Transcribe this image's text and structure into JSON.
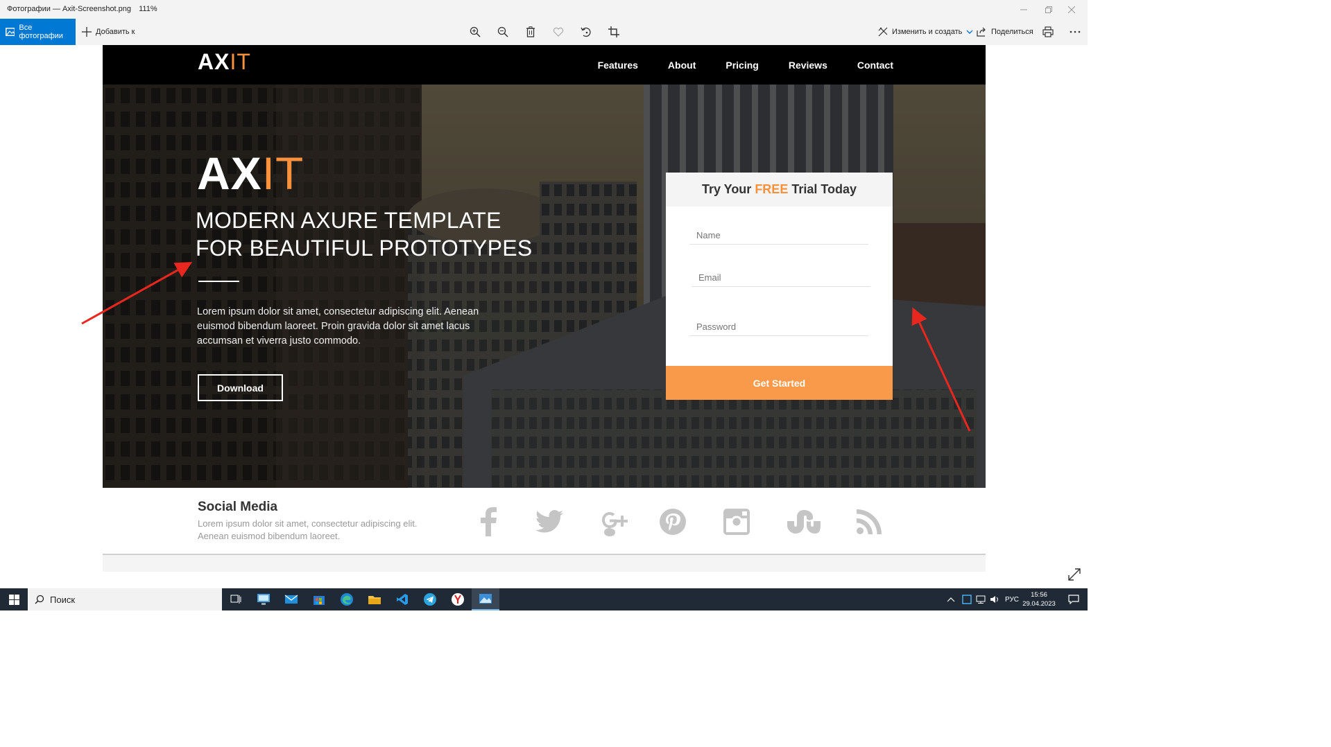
{
  "window": {
    "title": "Фотографии — Axit-Screenshot.png",
    "zoom": "111%"
  },
  "toolbar": {
    "all_photos": "Все фотографии",
    "add_to": "Добавить к",
    "edit_create": "Изменить и создать",
    "share": "Поделиться"
  },
  "site": {
    "logo_ax": "AX",
    "logo_it": "IT",
    "nav": [
      "Features",
      "About",
      "Pricing",
      "Reviews",
      "Contact"
    ],
    "hero": {
      "logo_ax": "AX",
      "logo_it": "IT",
      "title_line1": "MODERN AXURE TEMPLATE",
      "title_line2": "FOR BEAUTIFUL PROTOTYPES",
      "text": "Lorem ipsum dolor sit amet, consectetur adipiscing elit. Aenean euismod bibendum laoreet. Proin gravida dolor sit amet lacus accumsan et viverra justo commodo.",
      "download": "Download"
    },
    "form": {
      "head_pre": "Try Your",
      "head_free": "FREE",
      "head_post": "Trial Today",
      "name_placeholder": "Name",
      "email_placeholder": "Email",
      "password_placeholder": "Password",
      "submit": "Get Started"
    },
    "social": {
      "heading": "Social Media",
      "text": "Lorem ipsum dolor sit amet, consectetur adipiscing elit. Aenean euismod bibendum laoreet.",
      "icons": [
        "facebook-icon",
        "twitter-icon",
        "google-plus-icon",
        "pinterest-icon",
        "instagram-icon",
        "stumbleupon-icon",
        "rss-icon"
      ]
    }
  },
  "taskbar": {
    "search": "Поиск",
    "lang": "РУС",
    "time": "15:56",
    "date": "29.04.2023"
  },
  "colors": {
    "accent_orange": "#f7913d",
    "button_orange": "#f99a4a",
    "windows_blue": "#0078d4",
    "arrow_red": "#e8281f"
  }
}
